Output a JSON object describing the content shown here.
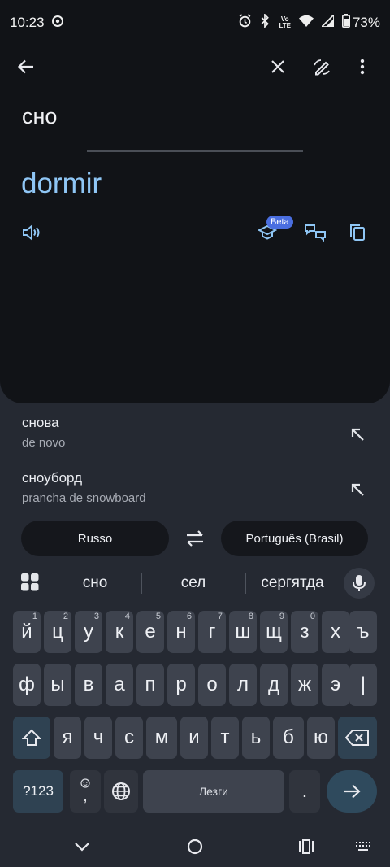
{
  "status_bar": {
    "time": "10:23",
    "network_badge_top": "Vo",
    "network_badge_bottom": "LTE",
    "battery": "73%"
  },
  "translation": {
    "source_text": "сно",
    "translated_text": "dormir",
    "beta_label": "Beta"
  },
  "suggestions": [
    {
      "word": "снова",
      "translation": "de novo"
    },
    {
      "word": "сноуборд",
      "translation": "prancha de snowboard"
    }
  ],
  "languages": {
    "source": "Russo",
    "target": "Português (Brasil)"
  },
  "keyboard": {
    "suggestions": [
      "сно",
      "сел",
      "сергятда"
    ],
    "row1": [
      {
        "char": "й",
        "hint": "1"
      },
      {
        "char": "ц",
        "hint": "2"
      },
      {
        "char": "у",
        "hint": "3"
      },
      {
        "char": "к",
        "hint": "4"
      },
      {
        "char": "е",
        "hint": "5"
      },
      {
        "char": "н",
        "hint": "6"
      },
      {
        "char": "г",
        "hint": "7"
      },
      {
        "char": "ш",
        "hint": "8"
      },
      {
        "char": "щ",
        "hint": "9"
      },
      {
        "char": "з",
        "hint": "0"
      },
      {
        "char": "х",
        "hint": ""
      },
      {
        "char": "ъ",
        "hint": ""
      }
    ],
    "row2": [
      "ф",
      "ы",
      "в",
      "а",
      "п",
      "р",
      "о",
      "л",
      "д",
      "ж",
      "э",
      "|"
    ],
    "row3": [
      "я",
      "ч",
      "с",
      "м",
      "и",
      "т",
      "ь",
      "б",
      "ю"
    ],
    "symbols_label": "?123",
    "comma_label": ",",
    "space_label": "Лезги",
    "period_label": "."
  }
}
